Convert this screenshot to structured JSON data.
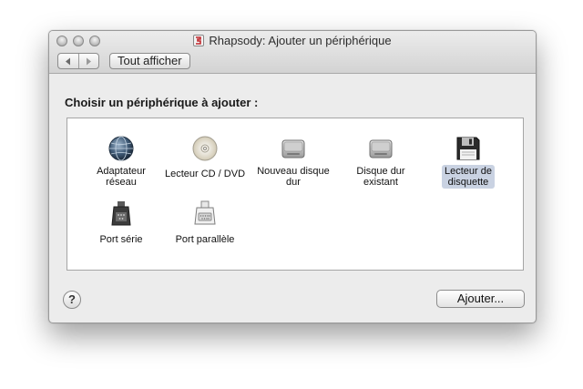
{
  "window": {
    "title": "Rhapsody: Ajouter un périphérique"
  },
  "toolbar": {
    "back_icon": "chevron-left-icon",
    "forward_icon": "chevron-right-icon",
    "show_all_label": "Tout afficher"
  },
  "main": {
    "heading": "Choisir un périphérique à ajouter :",
    "devices": [
      {
        "label": "Adaptateur\nréseau",
        "icon": "network-globe-icon",
        "selected": false
      },
      {
        "label": "Lecteur CD / DVD",
        "icon": "cd-dvd-icon",
        "selected": false
      },
      {
        "label": "Nouveau disque\ndur",
        "icon": "new-hard-disk-icon",
        "selected": false
      },
      {
        "label": "Disque dur\nexistant",
        "icon": "existing-hard-disk-icon",
        "selected": false
      },
      {
        "label": "Lecteur de\ndisquette",
        "icon": "floppy-disk-icon",
        "selected": true
      },
      {
        "label": "Port série",
        "icon": "serial-port-icon",
        "selected": false
      },
      {
        "label": "Port parallèle",
        "icon": "parallel-port-icon",
        "selected": false
      }
    ]
  },
  "footer": {
    "help_label": "?",
    "add_label": "Ajouter..."
  },
  "colors": {
    "selection": "#c9d2e2",
    "window_bg": "#ececec"
  }
}
